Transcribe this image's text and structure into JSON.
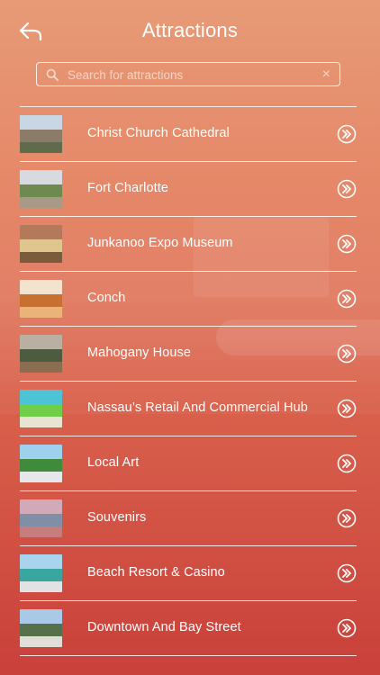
{
  "header": {
    "title": "Attractions",
    "back_icon": "back-arrow-icon"
  },
  "search": {
    "placeholder": "Search for attractions",
    "value": "",
    "clear_glyph": "×"
  },
  "items": [
    {
      "label": "Christ Church Cathedral",
      "thumb_colors": [
        "#c9d6e3",
        "#8d7b6a",
        "#5f6b4a"
      ]
    },
    {
      "label": "Fort Charlotte",
      "thumb_colors": [
        "#d7dbe0",
        "#6f8a4f",
        "#a89a86"
      ]
    },
    {
      "label": "Junkanoo Expo Museum",
      "thumb_colors": [
        "#b4795a",
        "#e0c58f",
        "#7a5c3c"
      ]
    },
    {
      "label": "Conch",
      "thumb_colors": [
        "#f2e3cf",
        "#c8702f",
        "#e9b37a"
      ]
    },
    {
      "label": "Mahogany House",
      "thumb_colors": [
        "#b9b0a2",
        "#4d5c3e",
        "#8a6e52"
      ]
    },
    {
      "label": "Nassau’s Retail And Commercial Hub",
      "thumb_colors": [
        "#4cc4d6",
        "#6fcf4a",
        "#e8e3d2"
      ]
    },
    {
      "label": "Local Art",
      "thumb_colors": [
        "#9fd0ee",
        "#3f8a3b",
        "#e5e7ea"
      ]
    },
    {
      "label": "Souvenirs",
      "thumb_colors": [
        "#d2a9b8",
        "#7f8fa6",
        "#c77d7d"
      ]
    },
    {
      "label": "Beach Resort & Casino",
      "thumb_colors": [
        "#a8d4ee",
        "#3aa6a0",
        "#e0e2e4"
      ]
    },
    {
      "label": "Downtown And Bay Street",
      "thumb_colors": [
        "#aac9e6",
        "#55704a",
        "#e1ded8"
      ]
    }
  ]
}
